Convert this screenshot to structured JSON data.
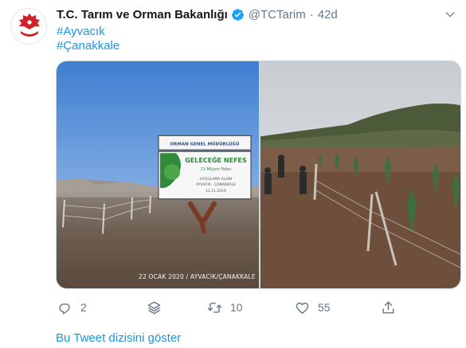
{
  "tweet": {
    "author_name": "T.C. Tarım ve Orman Bakanlığı",
    "handle": "@TCTarim",
    "separator": "·",
    "time": "42d",
    "hashtags": [
      "#Ayvacık",
      "#Çanakkale"
    ],
    "images": {
      "left": {
        "sign_header": "ORMAN GENEL MÜDÜRLÜĞÜ",
        "sign_title": "GELECEĞE NEFES",
        "sign_subtitle": "11 Milyon Fidan",
        "sign_line1": "UYGULAMA ALANI",
        "sign_line2": "AYVACIK - ÇANAKKALE",
        "sign_date": "11.11.2019",
        "caption": "22 OCAK 2020 / AYVACIK/ÇANAKKALE"
      },
      "right": {}
    }
  },
  "actions": {
    "reply_count": "2",
    "retweet_count": "10",
    "like_count": "55"
  },
  "thread_link": "Bu Tweet dizisini göster",
  "colors": {
    "link": "#1b95e0",
    "secondary": "#657786",
    "verified": "#1da1f2",
    "brand_red": "#d0232a"
  },
  "icons": {
    "avatar": "ministry-logo",
    "verified": "verified-badge-icon",
    "menu": "chevron-down-icon",
    "reply": "reply-icon",
    "stack": "stack-icon",
    "retweet": "retweet-icon",
    "like": "heart-icon",
    "share": "share-icon"
  }
}
